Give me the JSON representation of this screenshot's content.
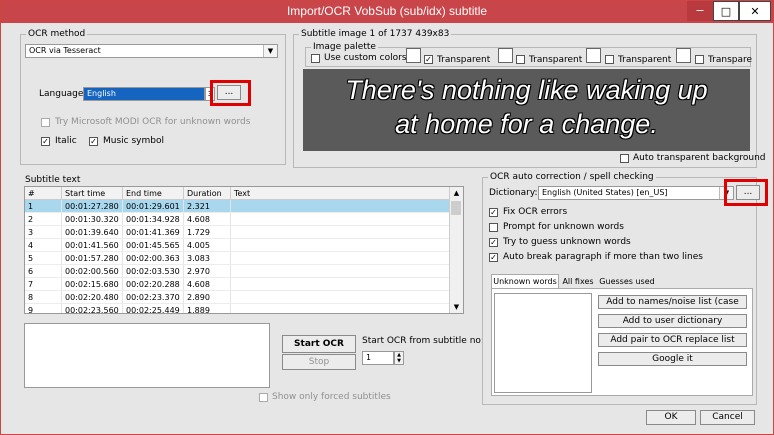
{
  "window": {
    "title": "Import/OCR VobSub (sub/idx) subtitle",
    "min_glyph": "−",
    "max_glyph": "□",
    "close_glyph": "✕"
  },
  "ocr_method": {
    "group_label": "OCR method",
    "selected": "OCR via Tesseract",
    "language_label": "Language",
    "language_value": "English",
    "language_spin": "3",
    "browse_label": "...",
    "modi_label": "Try Microsoft MODI OCR for unknown words",
    "italic_label": "Italic",
    "music_label": "Music symbol"
  },
  "subtitle_image": {
    "group_label": "Subtitle image 1 of 1737   439x83",
    "palette_label": "Image palette",
    "use_custom_colors": "Use custom colors",
    "transparent_labels": [
      "Transparent",
      "Transparent",
      "Transparent",
      "Transpare"
    ],
    "preview_lines": [
      "There's nothing like waking up",
      "at home for a change."
    ],
    "auto_transparent": "Auto transparent background"
  },
  "subtitle_text": {
    "group_label": "Subtitle text",
    "columns": [
      "#",
      "Start time",
      "End time",
      "Duration",
      "Text"
    ],
    "rows": [
      [
        "1",
        "00:01:27.280",
        "00:01:29.601",
        "2.321",
        ""
      ],
      [
        "2",
        "00:01:30.320",
        "00:01:34.928",
        "4.608",
        ""
      ],
      [
        "3",
        "00:01:39.640",
        "00:01:41.369",
        "1.729",
        ""
      ],
      [
        "4",
        "00:01:41.560",
        "00:01:45.565",
        "4.005",
        ""
      ],
      [
        "5",
        "00:01:57.280",
        "00:02:00.363",
        "3.083",
        ""
      ],
      [
        "6",
        "00:02:00.560",
        "00:02:03.530",
        "2.970",
        ""
      ],
      [
        "7",
        "00:02:15.680",
        "00:02:20.288",
        "4.608",
        ""
      ],
      [
        "8",
        "00:02:20.480",
        "00:02:23.370",
        "2.890",
        ""
      ],
      [
        "9",
        "00:02:23.560",
        "00:02:25.449",
        "1.889",
        ""
      ]
    ],
    "selected_row": 0
  },
  "start_ocr": {
    "start_label": "Start OCR",
    "stop_label": "Stop",
    "from_label": "Start OCR from subtitle no:",
    "from_value": "1",
    "forced_label": "Show only forced subtitles"
  },
  "autocorrect": {
    "group_label": "OCR auto correction / spell checking",
    "dictionary_label": "Dictionary:",
    "dictionary_value": "English (United States) [en_US]",
    "browse_label": "...",
    "fix_ocr": "Fix OCR errors",
    "prompt_unknown": "Prompt for unknown words",
    "guess_unknown": "Try to guess unknown words",
    "auto_break": "Auto break paragraph if more than two lines",
    "tabs": [
      "Unknown words",
      "All fixes",
      "Guesses used"
    ],
    "actions": [
      "Add to names/noise list (case",
      "Add to user dictionary",
      "Add pair to OCR replace list",
      "Google it"
    ]
  },
  "footer": {
    "ok": "OK",
    "cancel": "Cancel"
  }
}
